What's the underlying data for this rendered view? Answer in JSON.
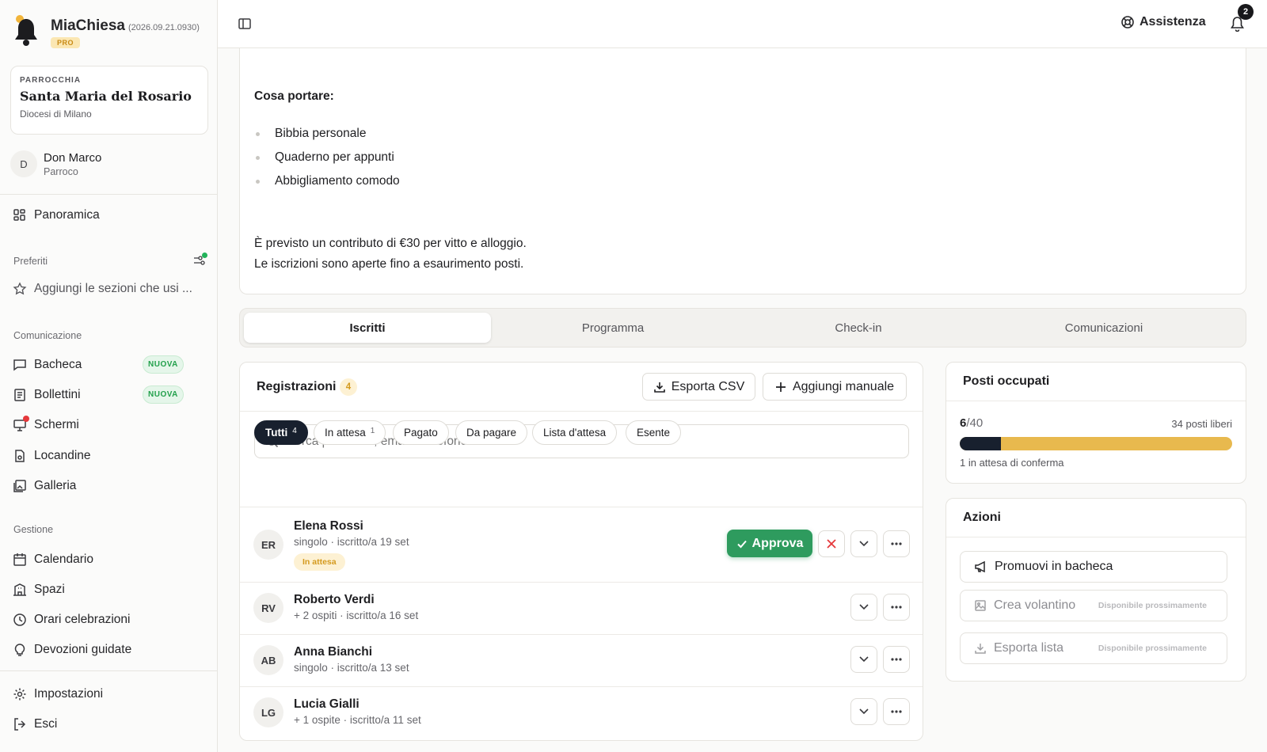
{
  "app": {
    "name": "MiaChiesa",
    "version": "(2026.09.21.0930)",
    "plan": "PRO"
  },
  "parish": {
    "label": "PARROCCHIA",
    "name": "Santa Maria del Rosario",
    "diocese": "Diocesi di Milano"
  },
  "user": {
    "initial": "D",
    "name": "Don Marco",
    "role": "Parroco"
  },
  "sidebar": {
    "overview": "Panoramica",
    "favorites_title": "Preferiti",
    "favorites_empty": "Aggiungi le sezioni che usi ...",
    "communication_title": "Comunicazione",
    "communication": [
      {
        "label": "Bacheca",
        "badge": "NUOVA"
      },
      {
        "label": "Bollettini",
        "badge": "NUOVA"
      },
      {
        "label": "Schermi",
        "badge": ""
      },
      {
        "label": "Locandine",
        "badge": ""
      },
      {
        "label": "Galleria",
        "badge": ""
      }
    ],
    "management_title": "Gestione",
    "management": [
      {
        "label": "Calendario"
      },
      {
        "label": "Spazi"
      },
      {
        "label": "Orari celebrazioni"
      },
      {
        "label": "Devozioni guidate"
      }
    ],
    "settings": "Impostazioni",
    "logout": "Esci"
  },
  "topbar": {
    "help": "Assistenza",
    "notifications_count": "2"
  },
  "description": {
    "bring_title": "Cosa portare:",
    "bring_items": [
      "Bibbia personale",
      "Quaderno per appunti",
      "Abbigliamento comodo"
    ],
    "fee_line": "È previsto un contributo di €30 per vitto e alloggio.",
    "open_line": "Le iscrizioni sono aperte fino a esaurimento posti."
  },
  "tabs": [
    "Iscritti",
    "Programma",
    "Check-in",
    "Comunicazioni"
  ],
  "registrations": {
    "title": "Registrazioni",
    "count": "4",
    "export_csv": "Esporta CSV",
    "add_manual": "Aggiungi manuale",
    "search_placeholder": "Cerca per nome, email o telefono...",
    "filters": [
      {
        "label": "Tutti",
        "count": "4"
      },
      {
        "label": "In attesa",
        "count": "1"
      },
      {
        "label": "Pagato",
        "count": ""
      },
      {
        "label": "Da pagare",
        "count": ""
      },
      {
        "label": "Lista d'attesa",
        "count": ""
      },
      {
        "label": "Esente",
        "count": ""
      }
    ],
    "rows": [
      {
        "initials": "ER",
        "name": "Elena Rossi",
        "detail": "singolo · iscritto/a 19 set",
        "status": "In attesa",
        "approve": "Approva"
      },
      {
        "initials": "RV",
        "name": "Roberto Verdi",
        "detail": "+ 2 ospiti · iscritto/a 16 set"
      },
      {
        "initials": "AB",
        "name": "Anna Bianchi",
        "detail": "singolo · iscritto/a 13 set"
      },
      {
        "initials": "LG",
        "name": "Lucia Gialli",
        "detail": "+ 1 ospite · iscritto/a 11 set"
      }
    ]
  },
  "seats": {
    "title": "Posti occupati",
    "occupied": "6",
    "total": "/40",
    "free": "34 posti liberi",
    "pending": "1 in attesa di conferma",
    "confirmed_fraction": 0.15,
    "total_fraction": 1.0
  },
  "actions": {
    "title": "Azioni",
    "items": [
      {
        "label": "Promuovi in bacheca",
        "note": ""
      },
      {
        "label": "Crea volantino",
        "note": "Disponibile prossimamente"
      },
      {
        "label": "Esporta lista",
        "note": "Disponibile prossimamente"
      }
    ]
  },
  "colors": {
    "accent": "#2e9b5e",
    "dark": "#18202e",
    "amber": "#e8b94e",
    "danger": "#e5383b"
  }
}
